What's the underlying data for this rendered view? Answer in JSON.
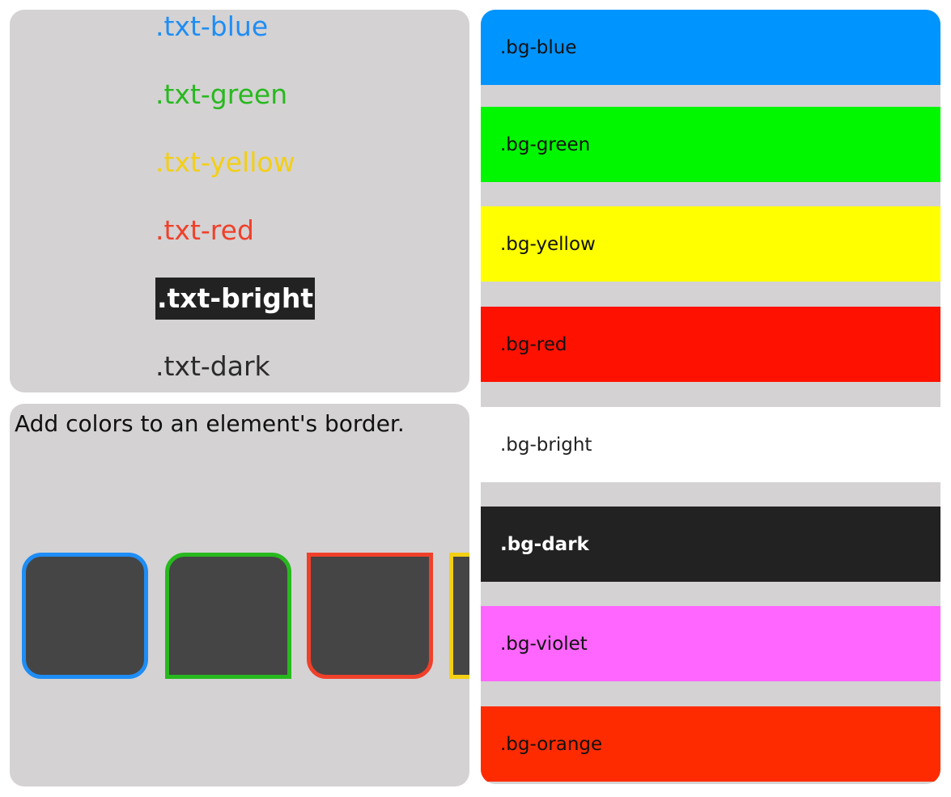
{
  "colors": {
    "blue": "#1e8df5",
    "green": "#27b91e",
    "yellow": "#f3cf15",
    "red": "#f0402a",
    "dark": "#232223",
    "bright": "#ffffff"
  },
  "text_samples": [
    {
      "label": ".txt-blue",
      "color": "#1e8df5"
    },
    {
      "label": ".txt-green",
      "color": "#27b91e"
    },
    {
      "label": ".txt-yellow",
      "color": "#f3cf15"
    },
    {
      "label": ".txt-red",
      "color": "#f0402a"
    },
    {
      "label": ".txt-bright",
      "color": "#ffffff",
      "highlight": "#232223"
    },
    {
      "label": ".txt-dark",
      "color": "#2b2b2b"
    }
  ],
  "border_section": {
    "description": "Add colors to an element's border.",
    "swatches": [
      {
        "name": "blue",
        "color": "#1e8df5"
      },
      {
        "name": "green",
        "color": "#27b91e"
      },
      {
        "name": "red",
        "color": "#f0402a"
      },
      {
        "name": "yellow",
        "color": "#f3cf15"
      }
    ]
  },
  "background_samples": [
    {
      "label": ".bg-blue",
      "bg": "#0094ff",
      "text": "#111111"
    },
    {
      "label": ".bg-green",
      "bg": "#00f700",
      "text": "#111111"
    },
    {
      "label": ".bg-yellow",
      "bg": "#ffff00",
      "text": "#111111"
    },
    {
      "label": ".bg-red",
      "bg": "#ff1100",
      "text": "#111111"
    },
    {
      "label": ".bg-bright",
      "bg": "#ffffff",
      "text": "#222222"
    },
    {
      "label": ".bg-dark",
      "bg": "#232223",
      "text": "#ffffff"
    },
    {
      "label": ".bg-violet",
      "bg": "#ff66ff",
      "text": "#111111"
    },
    {
      "label": ".bg-orange",
      "bg": "#ff2b00",
      "text": "#111111"
    }
  ]
}
